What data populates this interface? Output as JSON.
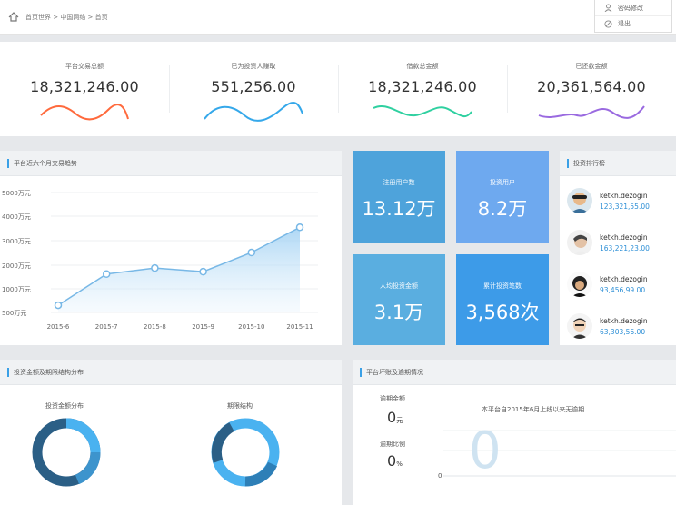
{
  "header": {
    "breadcrumb": "首页世界 > 中国网络 > 首页",
    "menu": [
      {
        "label": "密码修改",
        "icon": "user-icon"
      },
      {
        "label": "退出",
        "icon": "logout-icon"
      }
    ]
  },
  "stats": [
    {
      "label": "平台交易总额",
      "value": "18,321,246.00",
      "color": "#ff6a3d"
    },
    {
      "label": "已为投资人赚取",
      "value": "551,256.00",
      "color": "#35a8ea"
    },
    {
      "label": "借款总金额",
      "value": "18,321,246.00",
      "color": "#2fd0a0"
    },
    {
      "label": "已还款金额",
      "value": "20,361,564.00",
      "color": "#9a6ae0"
    }
  ],
  "trend": {
    "title": "平台近六个月交易趋势",
    "chart_data": {
      "type": "area",
      "categories": [
        "2015-6",
        "2015-7",
        "2015-8",
        "2015-9",
        "2015-10",
        "2015-11"
      ],
      "values": [
        30,
        160,
        185,
        170,
        250,
        355
      ],
      "ylim": [
        0,
        500
      ],
      "yticks": [
        "5000万元",
        "4000万元",
        "3000万元",
        "2000万元",
        "1000万元",
        "500万元"
      ],
      "grid": true
    }
  },
  "tiles": [
    {
      "label": "注册用户数",
      "value": "13.12万",
      "color": "#4ea3db"
    },
    {
      "label": "投资用户",
      "value": "8.2万",
      "color": "#6ea9ef"
    },
    {
      "label": "人均投资金额",
      "value": "3.1万",
      "color": "#5aaee0"
    },
    {
      "label": "累计投资笔数",
      "value": "3,568次",
      "color": "#3d9be8"
    }
  ],
  "ranking": {
    "title": "投资排行榜",
    "items": [
      {
        "name": "ketkh.dezogin",
        "value": "123,321,55.00"
      },
      {
        "name": "ketkh.dezogin",
        "value": "163,221,23.00"
      },
      {
        "name": "ketkh.dezogin",
        "value": "93,456,99.00"
      },
      {
        "name": "ketkh.dezogin",
        "value": "63,303,56.00"
      }
    ]
  },
  "distribution": {
    "title": "投资金额及期限结构分布",
    "donut1_label": "投资金额分布",
    "donut2_label": "期限结构"
  },
  "risk": {
    "title": "平台坏账及逾期情况",
    "overdue_label": "逾期金额",
    "overdue_value": "0",
    "overdue_unit": "元",
    "rate_label": "逾期比例",
    "rate_value": "0",
    "rate_unit": "%",
    "note": "本平台自2015年6月上线以来无逾期",
    "zero_axis": "0",
    "big_zero": "0"
  }
}
